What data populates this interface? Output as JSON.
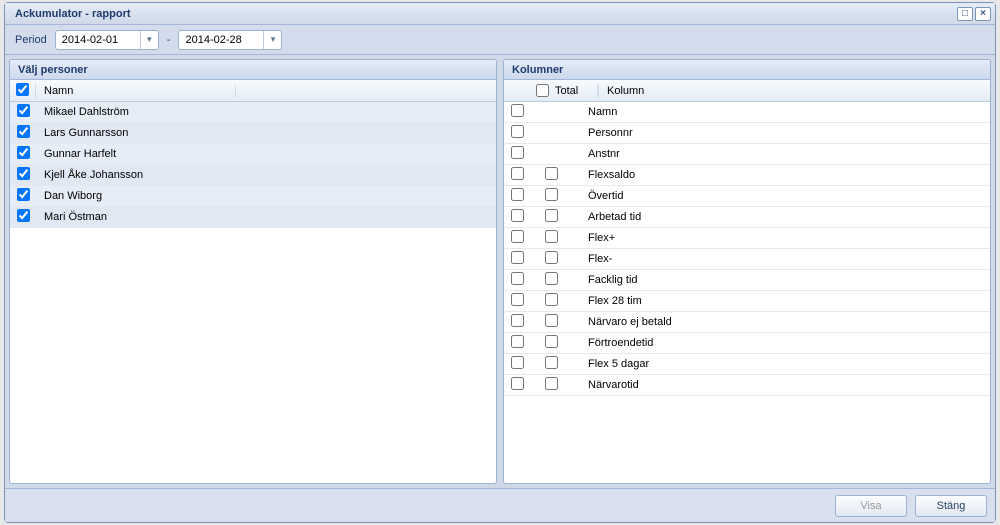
{
  "window": {
    "title": "Ackumulator - rapport"
  },
  "period": {
    "label": "Period",
    "from": "2014-02-01",
    "to": "2014-02-28"
  },
  "persons_panel": {
    "title": "Välj personer",
    "header_checkbox_checked": true,
    "name_header": "Namn",
    "rows": [
      {
        "checked": true,
        "name": "Mikael Dahlström"
      },
      {
        "checked": true,
        "name": "Lars Gunnarsson"
      },
      {
        "checked": true,
        "name": "Gunnar Harfelt"
      },
      {
        "checked": true,
        "name": "Kjell Åke Johansson"
      },
      {
        "checked": true,
        "name": "Dan Wiborg"
      },
      {
        "checked": true,
        "name": "Mari Östman"
      }
    ]
  },
  "columns_panel": {
    "title": "Kolumner",
    "total_header": "Total",
    "kolumn_header": "Kolumn",
    "rows": [
      {
        "checked": false,
        "show_total": false,
        "label": "Namn"
      },
      {
        "checked": false,
        "show_total": false,
        "label": "Personnr"
      },
      {
        "checked": false,
        "show_total": false,
        "label": "Anstnr"
      },
      {
        "checked": false,
        "show_total": true,
        "label": "Flexsaldo"
      },
      {
        "checked": false,
        "show_total": true,
        "label": "Övertid"
      },
      {
        "checked": false,
        "show_total": true,
        "label": "Arbetad tid"
      },
      {
        "checked": false,
        "show_total": true,
        "label": "Flex+"
      },
      {
        "checked": false,
        "show_total": true,
        "label": "Flex-"
      },
      {
        "checked": false,
        "show_total": true,
        "label": "Facklig tid"
      },
      {
        "checked": false,
        "show_total": true,
        "label": "Flex 28 tim"
      },
      {
        "checked": false,
        "show_total": true,
        "label": "Närvaro ej betald"
      },
      {
        "checked": false,
        "show_total": true,
        "label": "Förtroendetid"
      },
      {
        "checked": false,
        "show_total": true,
        "label": "Flex 5 dagar"
      },
      {
        "checked": false,
        "show_total": true,
        "label": "Närvarotid"
      }
    ]
  },
  "buttons": {
    "visa": "Visa",
    "stang": "Stäng"
  }
}
